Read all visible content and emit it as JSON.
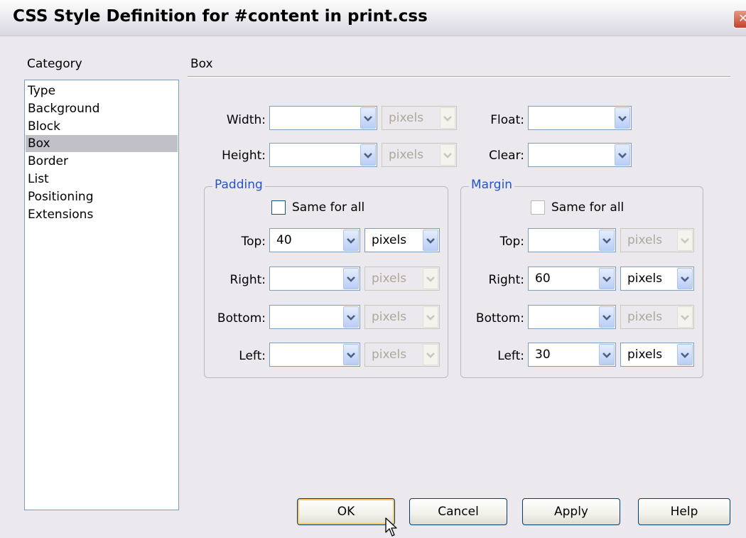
{
  "window": {
    "title": "CSS Style Definition for #content in print.css",
    "close_glyph": "✕"
  },
  "category": {
    "label": "Category",
    "items": [
      "Type",
      "Background",
      "Block",
      "Box",
      "Border",
      "List",
      "Positioning",
      "Extensions"
    ],
    "selected": "Box"
  },
  "section_title": "Box",
  "box": {
    "width": {
      "label": "Width:",
      "value": "",
      "unit": "pixels",
      "unit_enabled": false
    },
    "height": {
      "label": "Height:",
      "value": "",
      "unit": "pixels",
      "unit_enabled": false
    },
    "float": {
      "label": "Float:",
      "value": ""
    },
    "clear": {
      "label": "Clear:",
      "value": ""
    }
  },
  "padding": {
    "title": "Padding",
    "same_for_all": {
      "label": "Same for all",
      "checked": false
    },
    "top": {
      "label": "Top:",
      "value": "40",
      "unit": "pixels",
      "unit_enabled": true
    },
    "right": {
      "label": "Right:",
      "value": "",
      "unit": "pixels",
      "unit_enabled": false
    },
    "bottom": {
      "label": "Bottom:",
      "value": "",
      "unit": "pixels",
      "unit_enabled": false
    },
    "left": {
      "label": "Left:",
      "value": "",
      "unit": "pixels",
      "unit_enabled": false
    }
  },
  "margin": {
    "title": "Margin",
    "same_for_all": {
      "label": "Same for all",
      "checked": false
    },
    "top": {
      "label": "Top:",
      "value": "",
      "unit": "pixels",
      "unit_enabled": false
    },
    "right": {
      "label": "Right:",
      "value": "60",
      "unit": "pixels",
      "unit_enabled": true
    },
    "bottom": {
      "label": "Bottom:",
      "value": "",
      "unit": "pixels",
      "unit_enabled": false
    },
    "left": {
      "label": "Left:",
      "value": "30",
      "unit": "pixels",
      "unit_enabled": true
    }
  },
  "buttons": {
    "ok": "OK",
    "cancel": "Cancel",
    "apply": "Apply",
    "help": "Help"
  },
  "colors": {
    "group_title": "#2454c6",
    "selection": "#c1c0c8",
    "dialog_bg": "#ebe9ed"
  }
}
